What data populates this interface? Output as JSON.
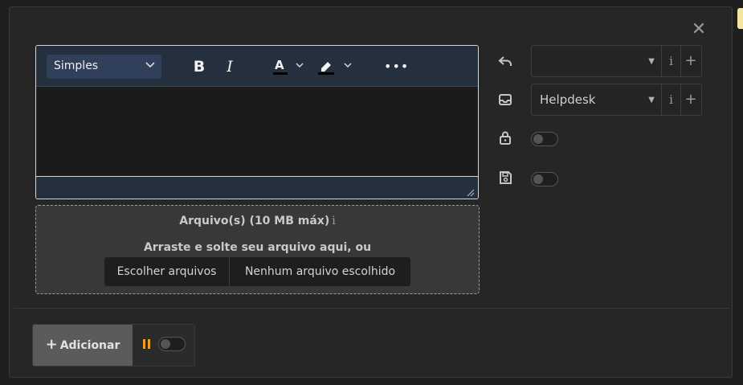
{
  "editor": {
    "style_select": "Simples",
    "toolbar_icons": [
      "bold-icon",
      "italic-icon",
      "font-color-icon",
      "highlight-color-icon",
      "more-icon"
    ],
    "bold_label": "B",
    "italic_label": "I",
    "font_color_letter": "A",
    "more_label": "•••"
  },
  "upload": {
    "title": "Arquivo(s) (10 MB máx)",
    "info_glyph": "i",
    "hint": "Arraste e solte seu arquivo aqui, ou",
    "choose_button": "Escolher arquivos",
    "no_file_text": "Nenhum arquivo escolhido"
  },
  "side": {
    "reply_select": {
      "value": "",
      "icon": "reply-icon"
    },
    "inbox_select": {
      "value": "Helpdesk",
      "icon": "inbox-icon"
    },
    "info_label": "i",
    "add_label": "+",
    "lock_toggle": {
      "on": false,
      "icon": "lock-icon"
    },
    "save_toggle": {
      "on": false,
      "icon": "save-icon"
    }
  },
  "footer": {
    "add_button": "Adicionar",
    "add_plus": "+",
    "toggle_on": false
  },
  "colors": {
    "toolbar_bg": "#25303f",
    "accent_orange": "#f0a020",
    "corner_tab": "#f3e6a3"
  },
  "close_label": "✕"
}
